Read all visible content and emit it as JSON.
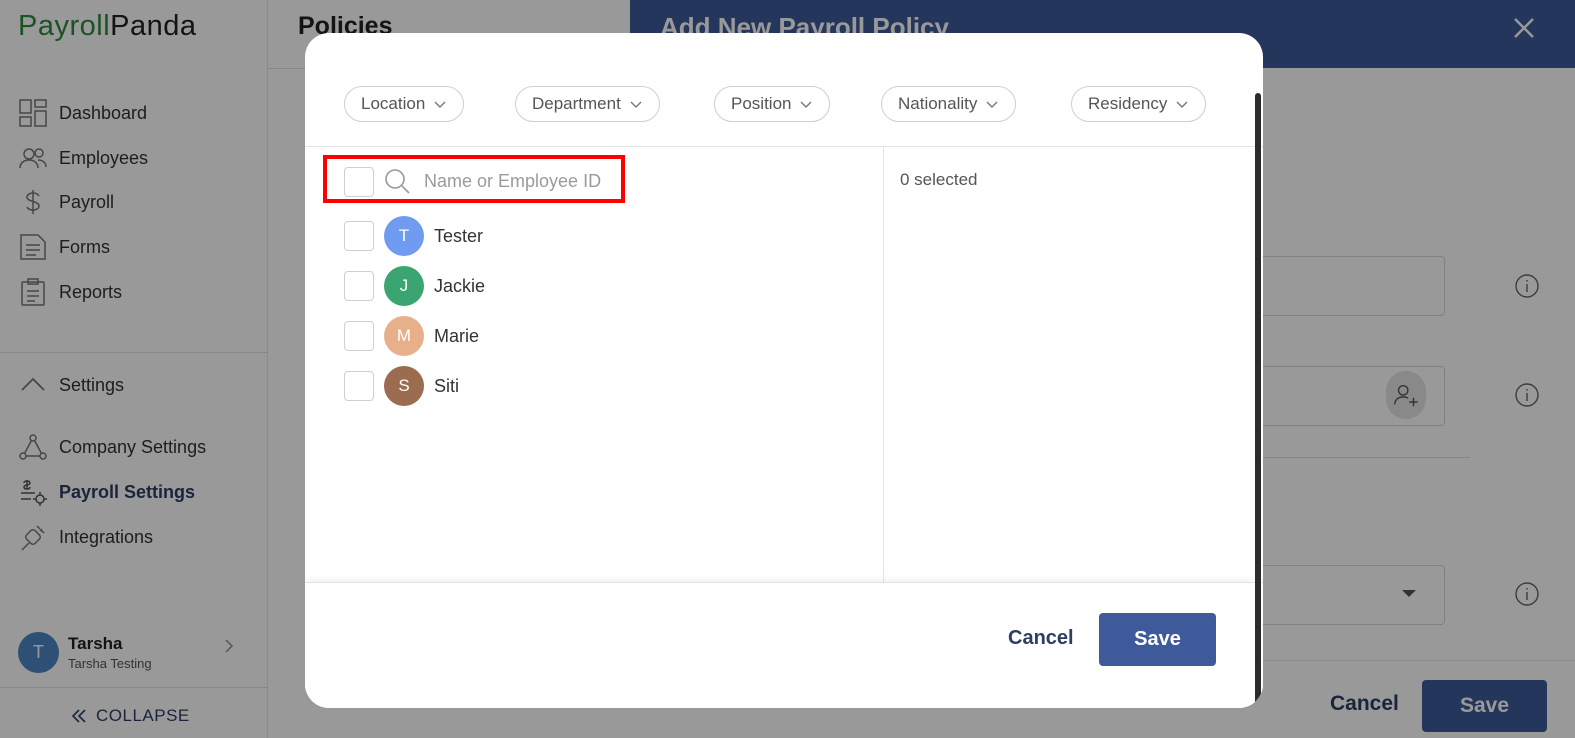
{
  "app": {
    "logo_part1": "Payroll",
    "logo_part2": "Panda"
  },
  "sidebar": {
    "items": [
      {
        "label": "Dashboard",
        "icon": "dashboard-icon"
      },
      {
        "label": "Employees",
        "icon": "employees-icon"
      },
      {
        "label": "Payroll",
        "icon": "dollar-icon"
      },
      {
        "label": "Forms",
        "icon": "forms-icon"
      },
      {
        "label": "Reports",
        "icon": "reports-icon"
      }
    ],
    "settings_label": "Settings",
    "settings_items": [
      {
        "label": "Company Settings",
        "icon": "company-settings-icon"
      },
      {
        "label": "Payroll Settings",
        "icon": "payroll-settings-icon",
        "active": true
      },
      {
        "label": "Integrations",
        "icon": "integrations-icon"
      }
    ],
    "user": {
      "initial": "T",
      "name": "Tarsha",
      "company": "Tarsha Testing"
    },
    "collapse_label": "COLLAPSE"
  },
  "main": {
    "title": "Policies"
  },
  "drawer": {
    "title": "Add New Payroll Policy",
    "cancel_label": "Cancel",
    "save_label": "Save"
  },
  "modal": {
    "filters": [
      "Location",
      "Department",
      "Position",
      "Nationality",
      "Residency"
    ],
    "search_placeholder": "Name or Employee ID",
    "selected_count": "0 selected",
    "employees": [
      {
        "initial": "T",
        "name": "Tester",
        "color": "#6f9bf0"
      },
      {
        "initial": "J",
        "name": "Jackie",
        "color": "#3aa571"
      },
      {
        "initial": "M",
        "name": "Marie",
        "color": "#e8b08a"
      },
      {
        "initial": "S",
        "name": "Siti",
        "color": "#9b6c4f"
      }
    ],
    "cancel_label": "Cancel",
    "save_label": "Save"
  },
  "colors": {
    "brand_green": "#2f8a3a",
    "primary": "#3f5a9a",
    "highlight": "#ff0000"
  }
}
